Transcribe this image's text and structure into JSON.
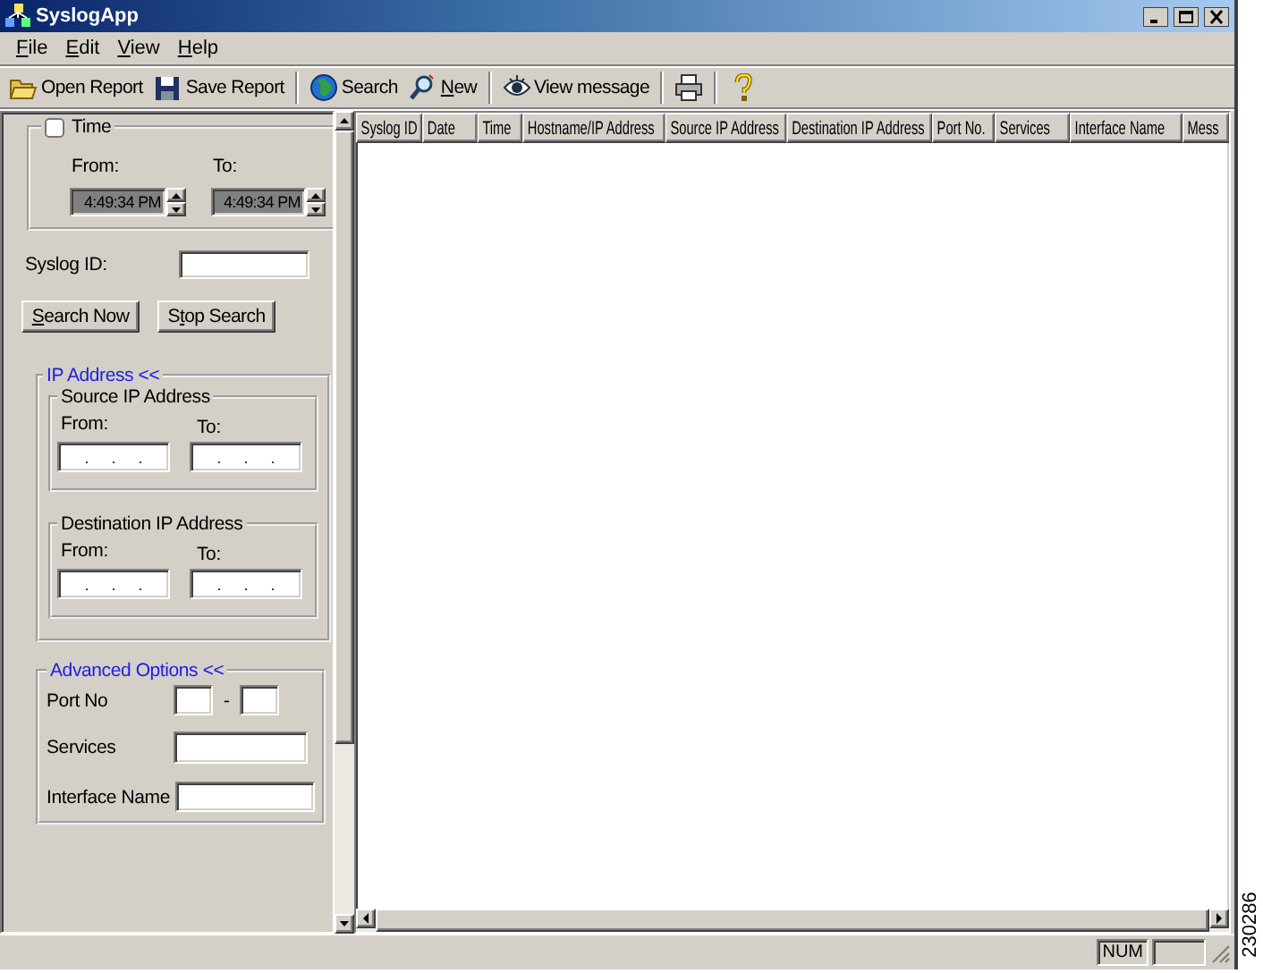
{
  "window": {
    "title": "SyslogApp"
  },
  "menu": [
    {
      "key": "F",
      "after": "ile"
    },
    {
      "key": "E",
      "after": "dit"
    },
    {
      "key": "V",
      "after": "iew"
    },
    {
      "key": "H",
      "after": "elp"
    }
  ],
  "toolbar": {
    "groups": [
      [
        {
          "kind": "text",
          "label": {
            "before": "Open Report"
          }
        },
        {
          "kind": "text",
          "label": {
            "before": "Save Report"
          }
        }
      ],
      [
        {
          "kind": "text",
          "label": {
            "before": "Search"
          }
        },
        {
          "kind": "text",
          "label": {
            "key": "N",
            "after": "ew"
          }
        }
      ],
      [
        {
          "kind": "text",
          "label": {
            "before": "View message"
          }
        }
      ],
      [
        {
          "kind": "icon"
        }
      ],
      [
        {
          "kind": "icon"
        }
      ]
    ]
  },
  "time_filter": {
    "label": "Time",
    "checked": false,
    "disabled": true,
    "from_label": "From:",
    "to_label": "To:",
    "from_value": "4:49:34 PM",
    "to_value": "4:49:34 PM"
  },
  "syslog_id": {
    "label": "Syslog ID:"
  },
  "buttons": [
    {
      "key": "S",
      "after": "earch Now"
    },
    {
      "before": "S",
      "key": "t",
      "after": "op Search"
    }
  ],
  "ip_address": {
    "title": "IP Address <<",
    "source": {
      "title": "Source IP Address",
      "from_label": "From:",
      "to_label": "To:"
    },
    "destination": {
      "title": "Destination IP Address",
      "from_label": "From:",
      "to_label": "To:"
    }
  },
  "advanced_options": {
    "title": "Advanced Options <<",
    "port_label": "Port No",
    "port_separator": "-",
    "services_label": "Services",
    "interface_label": "Interface Name"
  },
  "table": {
    "columns": [
      "Syslog ID",
      "Date",
      "Time",
      "Hostname/IP Address",
      "Source IP Address",
      "Destination IP Address",
      "Port No.",
      "Services",
      "Interface Name",
      "Mess"
    ]
  },
  "status_bar": {
    "panels": [
      "NUM"
    ]
  },
  "figure_id": "230286"
}
